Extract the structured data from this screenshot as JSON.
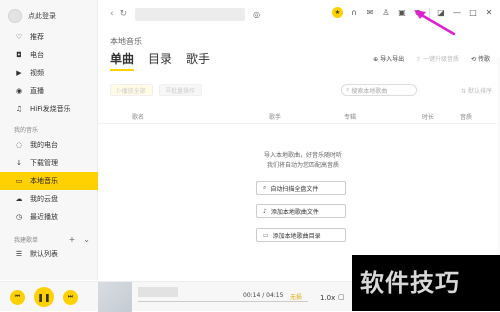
{
  "sidebar": {
    "login": "点此登录",
    "items": [
      {
        "label": "推荐",
        "icon": "heart-icon"
      },
      {
        "label": "电台",
        "icon": "radio-icon"
      },
      {
        "label": "视频",
        "icon": "video-icon"
      },
      {
        "label": "直播",
        "icon": "live-icon"
      },
      {
        "label": "HiFi发烧音乐",
        "icon": "hifi-icon"
      }
    ],
    "section_my_music": "我的音乐",
    "my_items": [
      {
        "label": "我的电台",
        "icon": "my-radio-icon"
      },
      {
        "label": "下载管理",
        "icon": "download-icon"
      },
      {
        "label": "本地音乐",
        "icon": "monitor-icon",
        "active": true
      },
      {
        "label": "我的云盘",
        "icon": "cloud-icon"
      },
      {
        "label": "最近播放",
        "icon": "clock-icon"
      }
    ],
    "section_playlist": "我建歌单",
    "playlist_items": [
      {
        "label": "默认列表",
        "icon": "playlist-icon"
      }
    ]
  },
  "main": {
    "page_title": "本地音乐",
    "tabs": [
      "单曲",
      "目录",
      "歌手"
    ],
    "header_actions": {
      "import_export": "导入导出",
      "upgrade": "一键升级音质",
      "transfer": "传歌"
    },
    "toolbar": {
      "play_all": "播放全部",
      "batch": "批量操作"
    },
    "search_placeholder": "搜索本地歌曲",
    "default_sort": "默认排序",
    "columns": [
      "歌名",
      "歌手",
      "专辑",
      "时长",
      "音质"
    ],
    "empty_line1": "导入本地歌曲，好音乐随时听",
    "empty_line2": "我们将自动为您匹配高音质",
    "actions": {
      "scan": "自动扫描全盘文件",
      "add_songs": "添加本地歌曲文件",
      "add_folder": "添加本地歌曲目录"
    }
  },
  "player": {
    "time": "00:14 / 04:15",
    "quality": "无损",
    "speed": "1.0x"
  },
  "watermark": "软件技巧",
  "colors": {
    "accent": "#ffd100",
    "annotation": "#e020d0"
  }
}
